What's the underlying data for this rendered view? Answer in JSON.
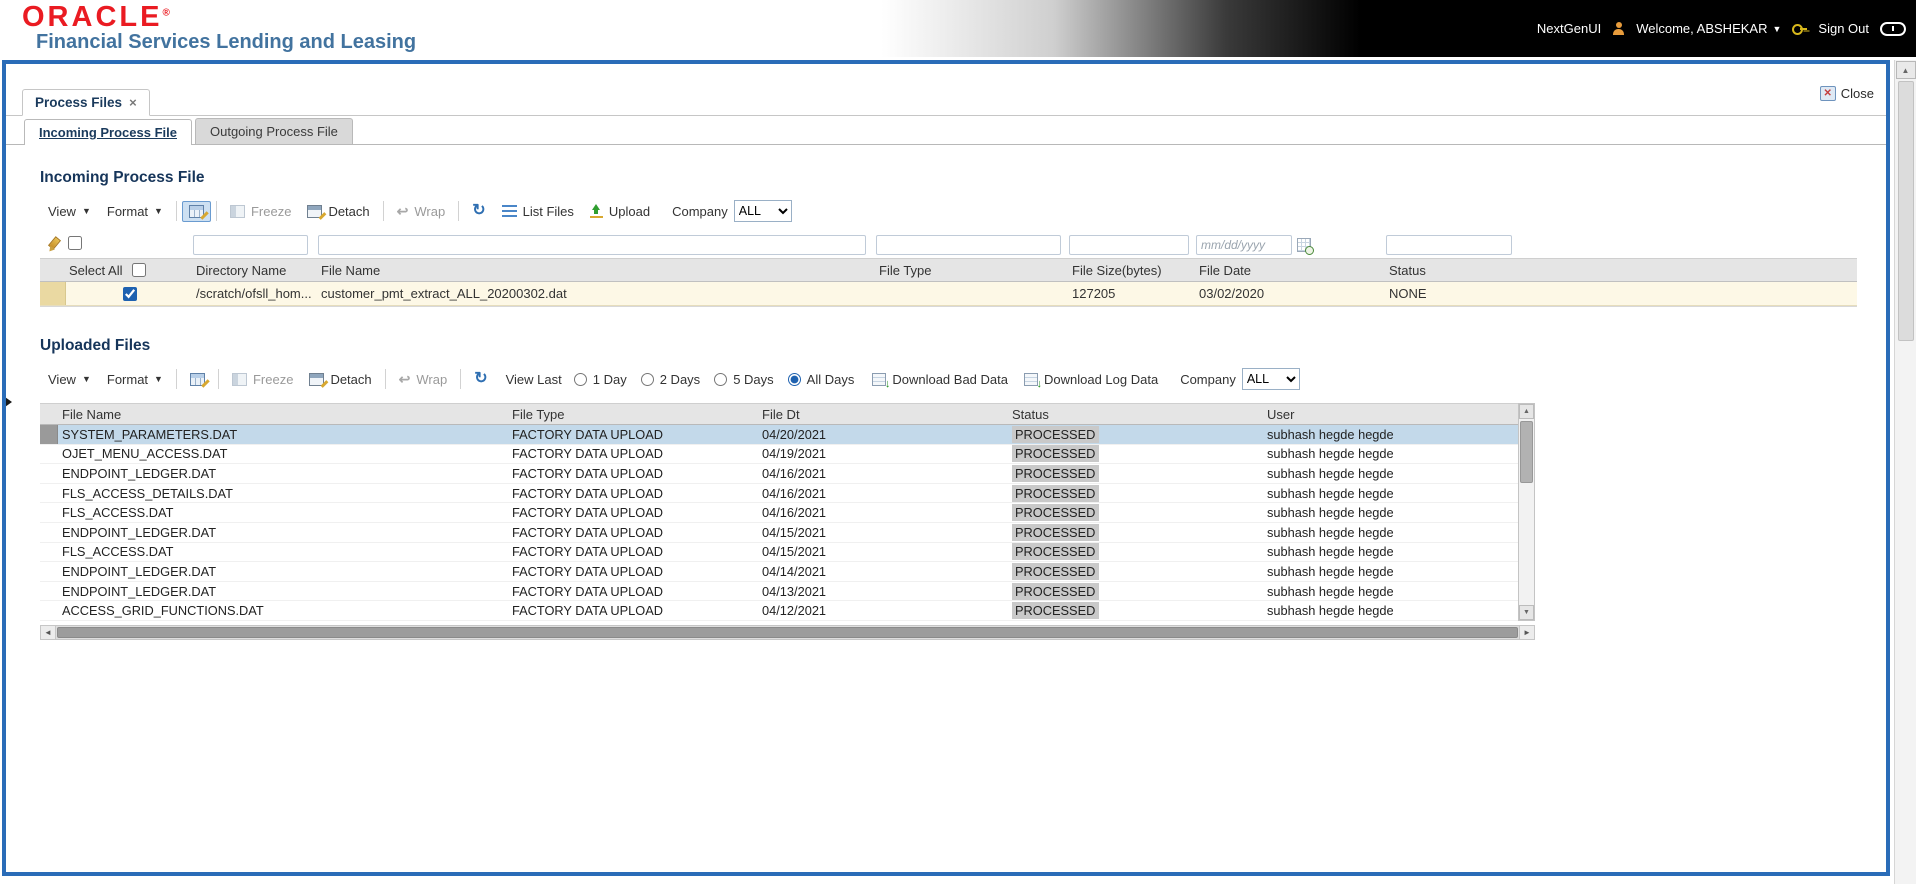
{
  "header": {
    "logo": "ORACLE",
    "logo_reg": "®",
    "subtitle": "Financial Services Lending and Leasing",
    "nextgen": "NextGenUI",
    "welcome": "Welcome, ABSHEKAR",
    "sign_out": "Sign Out"
  },
  "window": {
    "tab": "Process Files",
    "close": "Close"
  },
  "tabs": {
    "incoming": "Incoming Process File",
    "outgoing": "Outgoing Process File"
  },
  "incoming": {
    "title": "Incoming Process File",
    "toolbar": {
      "view": "View",
      "format": "Format",
      "freeze": "Freeze",
      "detach": "Detach",
      "wrap": "Wrap",
      "list_files": "List Files",
      "upload": "Upload",
      "company_label": "Company",
      "company_value": "ALL"
    },
    "filters": {
      "date_placeholder": "mm/dd/yyyy",
      "select_checkbox_checked": false
    },
    "columns": {
      "select_all": "Select All",
      "directory": "Directory Name",
      "file_name": "File Name",
      "file_type": "File Type",
      "file_size": "File Size(bytes)",
      "file_date": "File Date",
      "status": "Status"
    },
    "select_all_checked": false,
    "row": {
      "selected": true,
      "directory": "/scratch/ofsll_hom...",
      "file_name": "customer_pmt_extract_ALL_20200302.dat",
      "file_type": "",
      "file_size": "127205",
      "file_date": "03/02/2020",
      "status": "NONE"
    }
  },
  "uploaded": {
    "title": "Uploaded Files",
    "toolbar": {
      "view": "View",
      "format": "Format",
      "freeze": "Freeze",
      "detach": "Detach",
      "wrap": "Wrap",
      "view_last": "View Last",
      "options": [
        {
          "label": "1 Day",
          "selected": false
        },
        {
          "label": "2 Days",
          "selected": false
        },
        {
          "label": "5 Days",
          "selected": false
        },
        {
          "label": "All Days",
          "selected": true
        }
      ],
      "download_bad": "Download Bad Data",
      "download_log": "Download Log Data",
      "company_label": "Company",
      "company_value": "ALL"
    },
    "columns": {
      "file_name": "File Name",
      "file_type": "File Type",
      "file_dt": "File Dt",
      "status": "Status",
      "user": "User"
    },
    "rows": [
      {
        "file_name": "SYSTEM_PARAMETERS.DAT",
        "file_type": "FACTORY DATA UPLOAD",
        "file_dt": "04/20/2021",
        "status": "PROCESSED",
        "user": "subhash hegde hegde",
        "selected": true
      },
      {
        "file_name": "OJET_MENU_ACCESS.DAT",
        "file_type": "FACTORY DATA UPLOAD",
        "file_dt": "04/19/2021",
        "status": "PROCESSED",
        "user": "subhash hegde hegde",
        "selected": false
      },
      {
        "file_name": "ENDPOINT_LEDGER.DAT",
        "file_type": "FACTORY DATA UPLOAD",
        "file_dt": "04/16/2021",
        "status": "PROCESSED",
        "user": "subhash hegde hegde",
        "selected": false
      },
      {
        "file_name": "FLS_ACCESS_DETAILS.DAT",
        "file_type": "FACTORY DATA UPLOAD",
        "file_dt": "04/16/2021",
        "status": "PROCESSED",
        "user": "subhash hegde hegde",
        "selected": false
      },
      {
        "file_name": "FLS_ACCESS.DAT",
        "file_type": "FACTORY DATA UPLOAD",
        "file_dt": "04/16/2021",
        "status": "PROCESSED",
        "user": "subhash hegde hegde",
        "selected": false
      },
      {
        "file_name": "ENDPOINT_LEDGER.DAT",
        "file_type": "FACTORY DATA UPLOAD",
        "file_dt": "04/15/2021",
        "status": "PROCESSED",
        "user": "subhash hegde hegde",
        "selected": false
      },
      {
        "file_name": "FLS_ACCESS.DAT",
        "file_type": "FACTORY DATA UPLOAD",
        "file_dt": "04/15/2021",
        "status": "PROCESSED",
        "user": "subhash hegde hegde",
        "selected": false
      },
      {
        "file_name": "ENDPOINT_LEDGER.DAT",
        "file_type": "FACTORY DATA UPLOAD",
        "file_dt": "04/14/2021",
        "status": "PROCESSED",
        "user": "subhash hegde hegde",
        "selected": false
      },
      {
        "file_name": "ENDPOINT_LEDGER.DAT",
        "file_type": "FACTORY DATA UPLOAD",
        "file_dt": "04/13/2021",
        "status": "PROCESSED",
        "user": "subhash hegde hegde",
        "selected": false
      },
      {
        "file_name": "ACCESS_GRID_FUNCTIONS.DAT",
        "file_type": "FACTORY DATA UPLOAD",
        "file_dt": "04/12/2021",
        "status": "PROCESSED",
        "user": "subhash hegde hegde",
        "selected": false
      }
    ]
  },
  "colors": {
    "oracle_red": "#ea1b22",
    "brand_blue": "#42739f",
    "frame_blue": "#2a6cb8",
    "heading_navy": "#16355a",
    "selected_row": "#c3d9ea",
    "status_chip_gray": "#c9c9c9",
    "incoming_row_cream": "#fdf8e6"
  }
}
